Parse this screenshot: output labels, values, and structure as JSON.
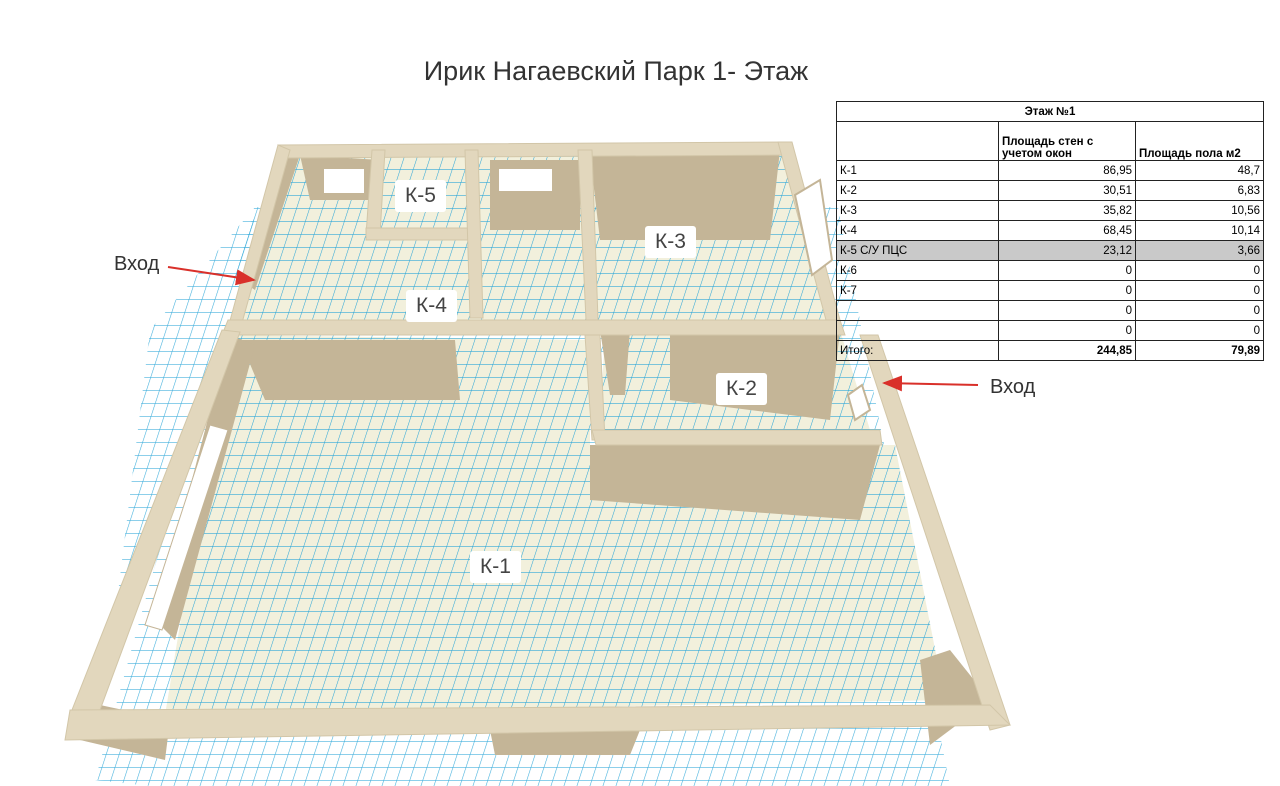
{
  "title": "Ирик Нагаевский Парк 1- Этаж",
  "rooms": {
    "k1": "К-1",
    "k2": "К-2",
    "k3": "К-3",
    "k4": "К-4",
    "k5": "К-5"
  },
  "entries": {
    "left": "Вход",
    "right": "Вход"
  },
  "table": {
    "header": "Этаж №1",
    "col1": "Площадь стен с учетом окон",
    "col2": "Площадь пола м2",
    "rows": [
      {
        "name": "К-1",
        "walls": "86,95",
        "floor": "48,7"
      },
      {
        "name": "К-2",
        "walls": "30,51",
        "floor": "6,83"
      },
      {
        "name": "К-3",
        "walls": "35,82",
        "floor": "10,56"
      },
      {
        "name": "К-4",
        "walls": "68,45",
        "floor": "10,14"
      },
      {
        "name": "К-5 С/У ПЦС",
        "walls": "23,12",
        "floor": "3,66"
      },
      {
        "name": "К-6",
        "walls": "0",
        "floor": "0"
      },
      {
        "name": "К-7",
        "walls": "0",
        "floor": "0"
      },
      {
        "name": "",
        "walls": "0",
        "floor": "0"
      },
      {
        "name": "",
        "walls": "0",
        "floor": "0"
      }
    ],
    "total_label": "Итого:",
    "total_walls": "244,85",
    "total_floor": "79,89"
  },
  "colors": {
    "wall_top": "#e2d7bd",
    "wall_side": "#c4b597",
    "floor": "#f2f0dc",
    "grid": "#2aa6d8",
    "arrow": "#d9302a"
  }
}
